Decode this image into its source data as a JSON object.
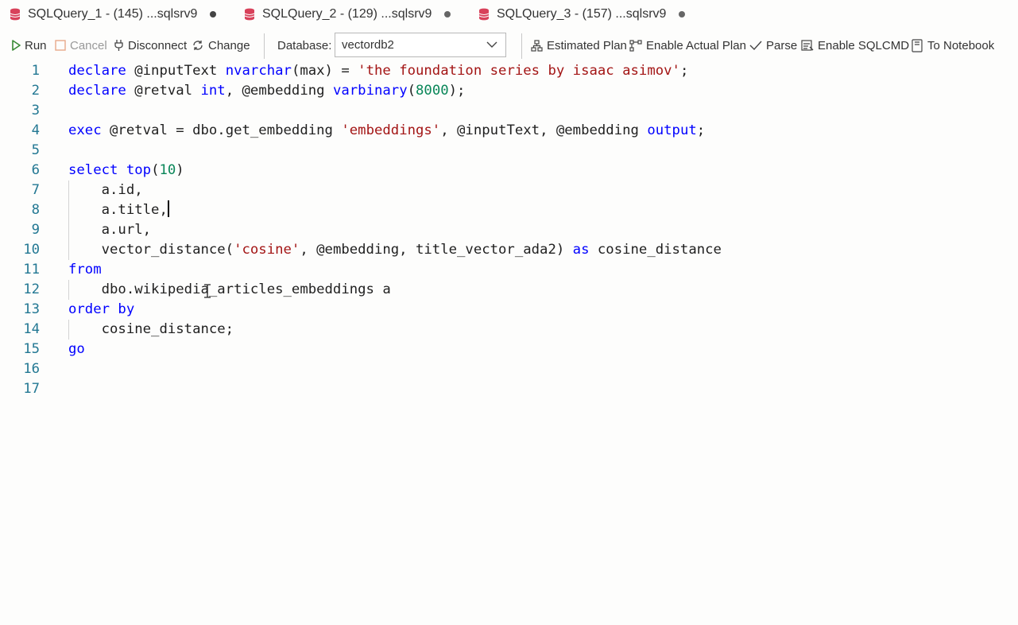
{
  "tabs": [
    {
      "label": "SQLQuery_1 - (145) ...sqlsrv9"
    },
    {
      "label": "SQLQuery_2 - (129) ...sqlsrv9"
    },
    {
      "label": "SQLQuery_3 - (157) ...sqlsrv9"
    }
  ],
  "toolbar": {
    "run": "Run",
    "cancel": "Cancel",
    "disconnect": "Disconnect",
    "change": "Change",
    "database_label": "Database:",
    "database_value": "vectordb2",
    "estimated_plan": "Estimated Plan",
    "enable_actual_plan": "Enable Actual Plan",
    "parse": "Parse",
    "enable_sqlcmd": "Enable SQLCMD",
    "to_notebook": "To Notebook"
  },
  "colors": {
    "keyword": "#0000ff",
    "string": "#a31515",
    "number": "#098658",
    "line_number": "#237893",
    "run_icon": "#388a34",
    "tab_icon": "#d8415a"
  },
  "editor": {
    "line_numbers": [
      "1",
      "2",
      "3",
      "4",
      "5",
      "6",
      "7",
      "8",
      "9",
      "10",
      "11",
      "12",
      "13",
      "14",
      "15",
      "16",
      "17"
    ],
    "lines": [
      [
        {
          "t": "declare",
          "c": "kw"
        },
        {
          "t": " @inputText "
        },
        {
          "t": "nvarchar",
          "c": "kw"
        },
        {
          "t": "(max) = "
        },
        {
          "t": "'the foundation series by isaac asimov'",
          "c": "str"
        },
        {
          "t": ";"
        }
      ],
      [
        {
          "t": "declare",
          "c": "kw"
        },
        {
          "t": " @retval "
        },
        {
          "t": "int",
          "c": "kw"
        },
        {
          "t": ", @embedding "
        },
        {
          "t": "varbinary",
          "c": "kw"
        },
        {
          "t": "("
        },
        {
          "t": "8000",
          "c": "num"
        },
        {
          "t": ");"
        }
      ],
      [],
      [
        {
          "t": "exec",
          "c": "kw"
        },
        {
          "t": " @retval = dbo.get_embedding "
        },
        {
          "t": "'embeddings'",
          "c": "str"
        },
        {
          "t": ", @inputText, @embedding "
        },
        {
          "t": "output",
          "c": "kw"
        },
        {
          "t": ";"
        }
      ],
      [],
      [
        {
          "t": "select",
          "c": "kw"
        },
        {
          "t": " "
        },
        {
          "t": "top",
          "c": "kw"
        },
        {
          "t": "("
        },
        {
          "t": "10",
          "c": "num"
        },
        {
          "t": ")"
        }
      ],
      [
        {
          "t": "    a.id,"
        }
      ],
      [
        {
          "t": "    a.title,"
        }
      ],
      [
        {
          "t": "    a.url,"
        }
      ],
      [
        {
          "t": "    vector_distance("
        },
        {
          "t": "'cosine'",
          "c": "str"
        },
        {
          "t": ", @embedding, title_vector_ada2) "
        },
        {
          "t": "as",
          "c": "kw"
        },
        {
          "t": " cosine_distance"
        }
      ],
      [
        {
          "t": "from",
          "c": "kw"
        }
      ],
      [
        {
          "t": "    dbo.wikipedia_articles_embeddings a"
        }
      ],
      [
        {
          "t": "order by",
          "c": "kw"
        }
      ],
      [
        {
          "t": "    cosine_distance;"
        }
      ],
      [
        {
          "t": "go",
          "c": "kw"
        }
      ],
      [],
      []
    ]
  },
  "icons": {
    "tab": "database-icon",
    "run": "play-icon",
    "cancel": "stop-icon",
    "disconnect": "plug-icon",
    "change": "refresh-icon",
    "estimated_plan": "plan-icon",
    "actual_plan": "actual-plan-icon",
    "parse": "checkmark-icon",
    "sqlcmd": "sqlcmd-icon",
    "notebook": "notebook-icon"
  }
}
